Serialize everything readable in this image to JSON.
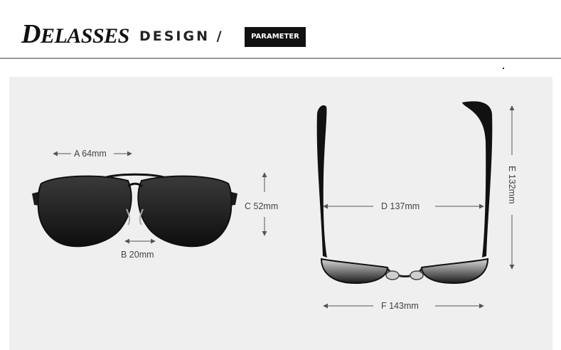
{
  "header": {
    "brand_initial": "D",
    "brand_rest": "ELASSES",
    "section": "DESIGN /",
    "badge": "PARAMETER"
  },
  "dimensions": {
    "a": "A 64mm",
    "b": "B 20mm",
    "c": "C 52mm",
    "d": "D 137mm",
    "e": "E 132mm",
    "f": "F 143mm"
  },
  "colors": {
    "panel": "#efefef",
    "lens": "#1e1e1e",
    "frame": "#111111",
    "measure": "#555555"
  }
}
